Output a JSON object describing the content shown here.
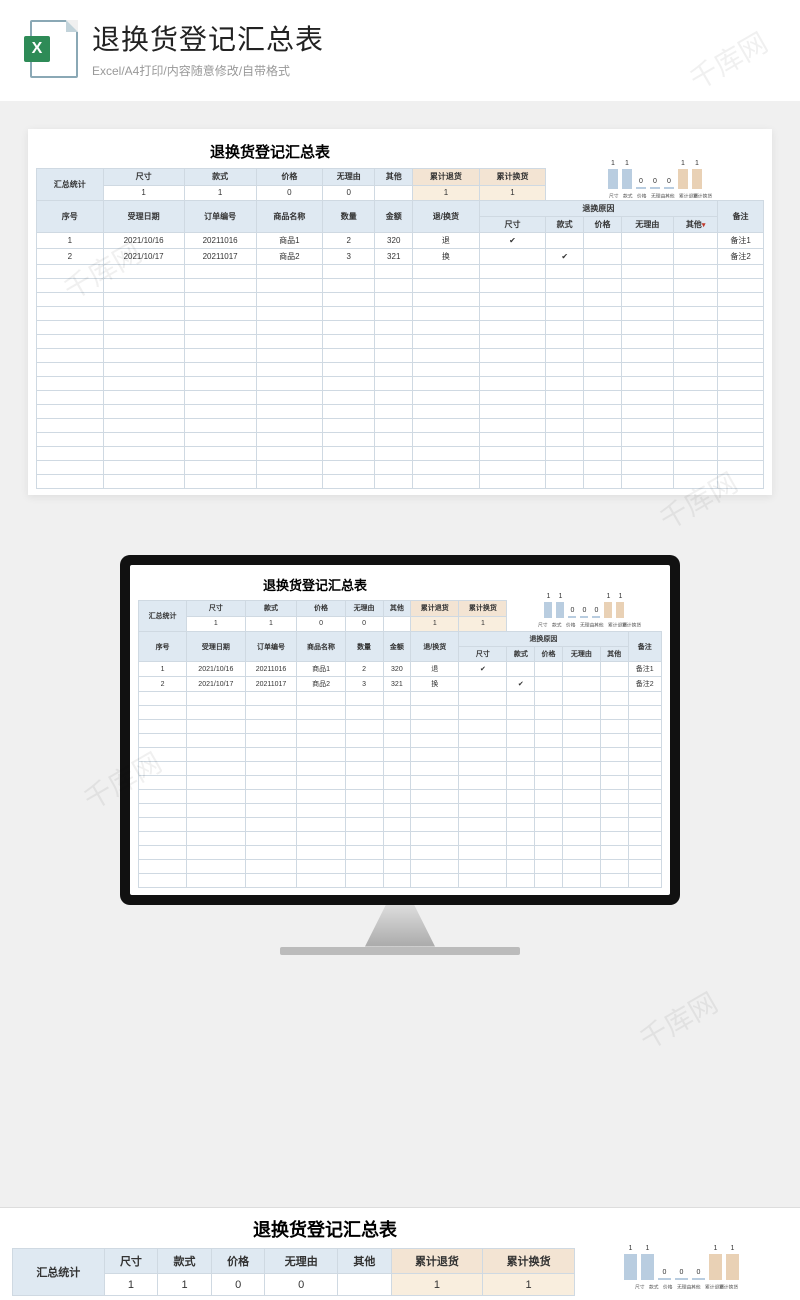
{
  "hero": {
    "title": "退换货登记汇总表",
    "subtitle": "Excel/A4打印/内容随意修改/自带格式",
    "icon_letter": "X"
  },
  "watermark": "千库网",
  "sheet": {
    "title": "退换货登记汇总表",
    "summary_label": "汇总统计",
    "summary_headers": [
      "尺寸",
      "款式",
      "价格",
      "无理由",
      "其他",
      "累计退货",
      "累计换货"
    ],
    "summary_values": [
      "1",
      "1",
      "0",
      "0",
      "",
      "1",
      "1"
    ],
    "detail_headers_row1": [
      "序号",
      "受理日期",
      "订单编号",
      "商品名称",
      "数量",
      "金额",
      "退/换货",
      "退换原因",
      "备注"
    ],
    "reason_sub_headers": [
      "尺寸",
      "款式",
      "价格",
      "无理由",
      "其他"
    ],
    "rows": [
      {
        "no": "1",
        "date": "2021/10/16",
        "order": "20211016",
        "name": "商品1",
        "qty": "2",
        "amt": "320",
        "type": "退",
        "size": "✔",
        "style": "",
        "price": "",
        "noreason": "",
        "other": "",
        "note": "备注1"
      },
      {
        "no": "2",
        "date": "2021/10/17",
        "order": "20211017",
        "name": "商品2",
        "qty": "3",
        "amt": "321",
        "type": "换",
        "size": "",
        "style": "✔",
        "price": "",
        "noreason": "",
        "other": "",
        "note": "备注2"
      }
    ],
    "other_dropdown_marker": "▾"
  },
  "chart_data": {
    "type": "bar",
    "categories": [
      "尺寸",
      "款式",
      "价格",
      "无理由",
      "其他",
      "累计退货",
      "累计换货"
    ],
    "values": [
      1,
      1,
      0,
      0,
      0,
      1,
      1
    ],
    "series_color_hint": [
      "blue",
      "blue",
      "blue",
      "blue",
      "blue",
      "tan",
      "tan"
    ],
    "ylim": [
      0,
      1
    ]
  }
}
